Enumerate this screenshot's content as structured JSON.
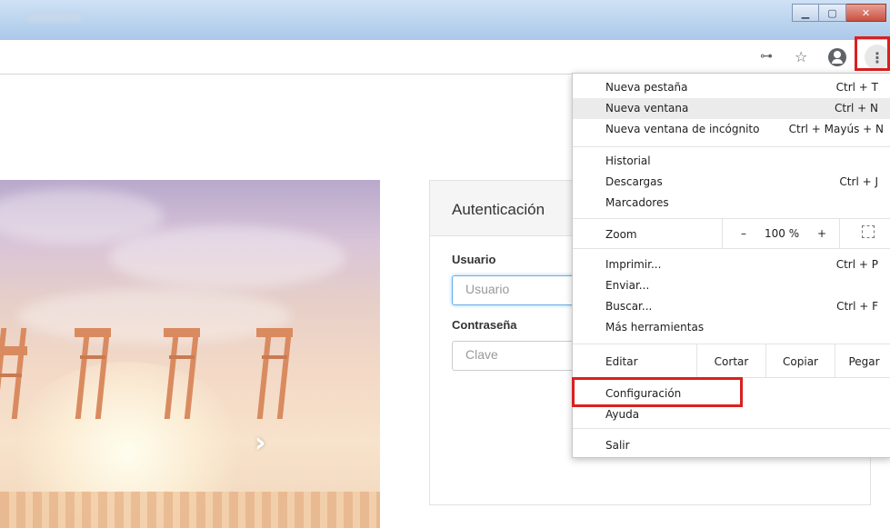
{
  "window": {
    "controls": {
      "minimize": "▁",
      "maximize": "▢",
      "close": "✕"
    }
  },
  "toolbar": {
    "icons": [
      "key-icon",
      "star-icon",
      "account-icon",
      "menu-icon"
    ],
    "key_glyph": "⊶",
    "star_glyph": "☆",
    "menu_glyph": "⋮"
  },
  "hero": {
    "next_glyph": "›"
  },
  "login": {
    "title": "Autenticación",
    "user_label": "Usuario",
    "user_placeholder": "Usuario",
    "pass_label": "Contraseña",
    "pass_placeholder": "Clave"
  },
  "menu": {
    "items": [
      {
        "label": "Nueva pestaña",
        "shortcut": "Ctrl + T"
      },
      {
        "label": "Nueva ventana",
        "shortcut": "Ctrl + N"
      },
      {
        "label": "Nueva ventana de incógnito",
        "shortcut": "Ctrl + Mayús + N"
      },
      {
        "label": "Historial",
        "shortcut": ""
      },
      {
        "label": "Descargas",
        "shortcut": "Ctrl + J"
      },
      {
        "label": "Marcadores",
        "shortcut": ""
      },
      {
        "label": "Imprimir...",
        "shortcut": "Ctrl + P"
      },
      {
        "label": "Enviar...",
        "shortcut": ""
      },
      {
        "label": "Buscar...",
        "shortcut": "Ctrl + F"
      },
      {
        "label": "Más herramientas",
        "shortcut": ""
      },
      {
        "label": "Configuración",
        "shortcut": ""
      },
      {
        "label": "Ayuda",
        "shortcut": ""
      },
      {
        "label": "Salir",
        "shortcut": ""
      }
    ],
    "zoom": {
      "label": "Zoom",
      "minus": "–",
      "value": "100 %",
      "plus": "+"
    },
    "edit": {
      "label": "Editar",
      "cut": "Cortar",
      "copy": "Copiar",
      "paste": "Pegar"
    },
    "submenu_arrow": "▸"
  },
  "colors": {
    "highlight": "#d9201f",
    "menu_hover": "#ebebeb"
  }
}
